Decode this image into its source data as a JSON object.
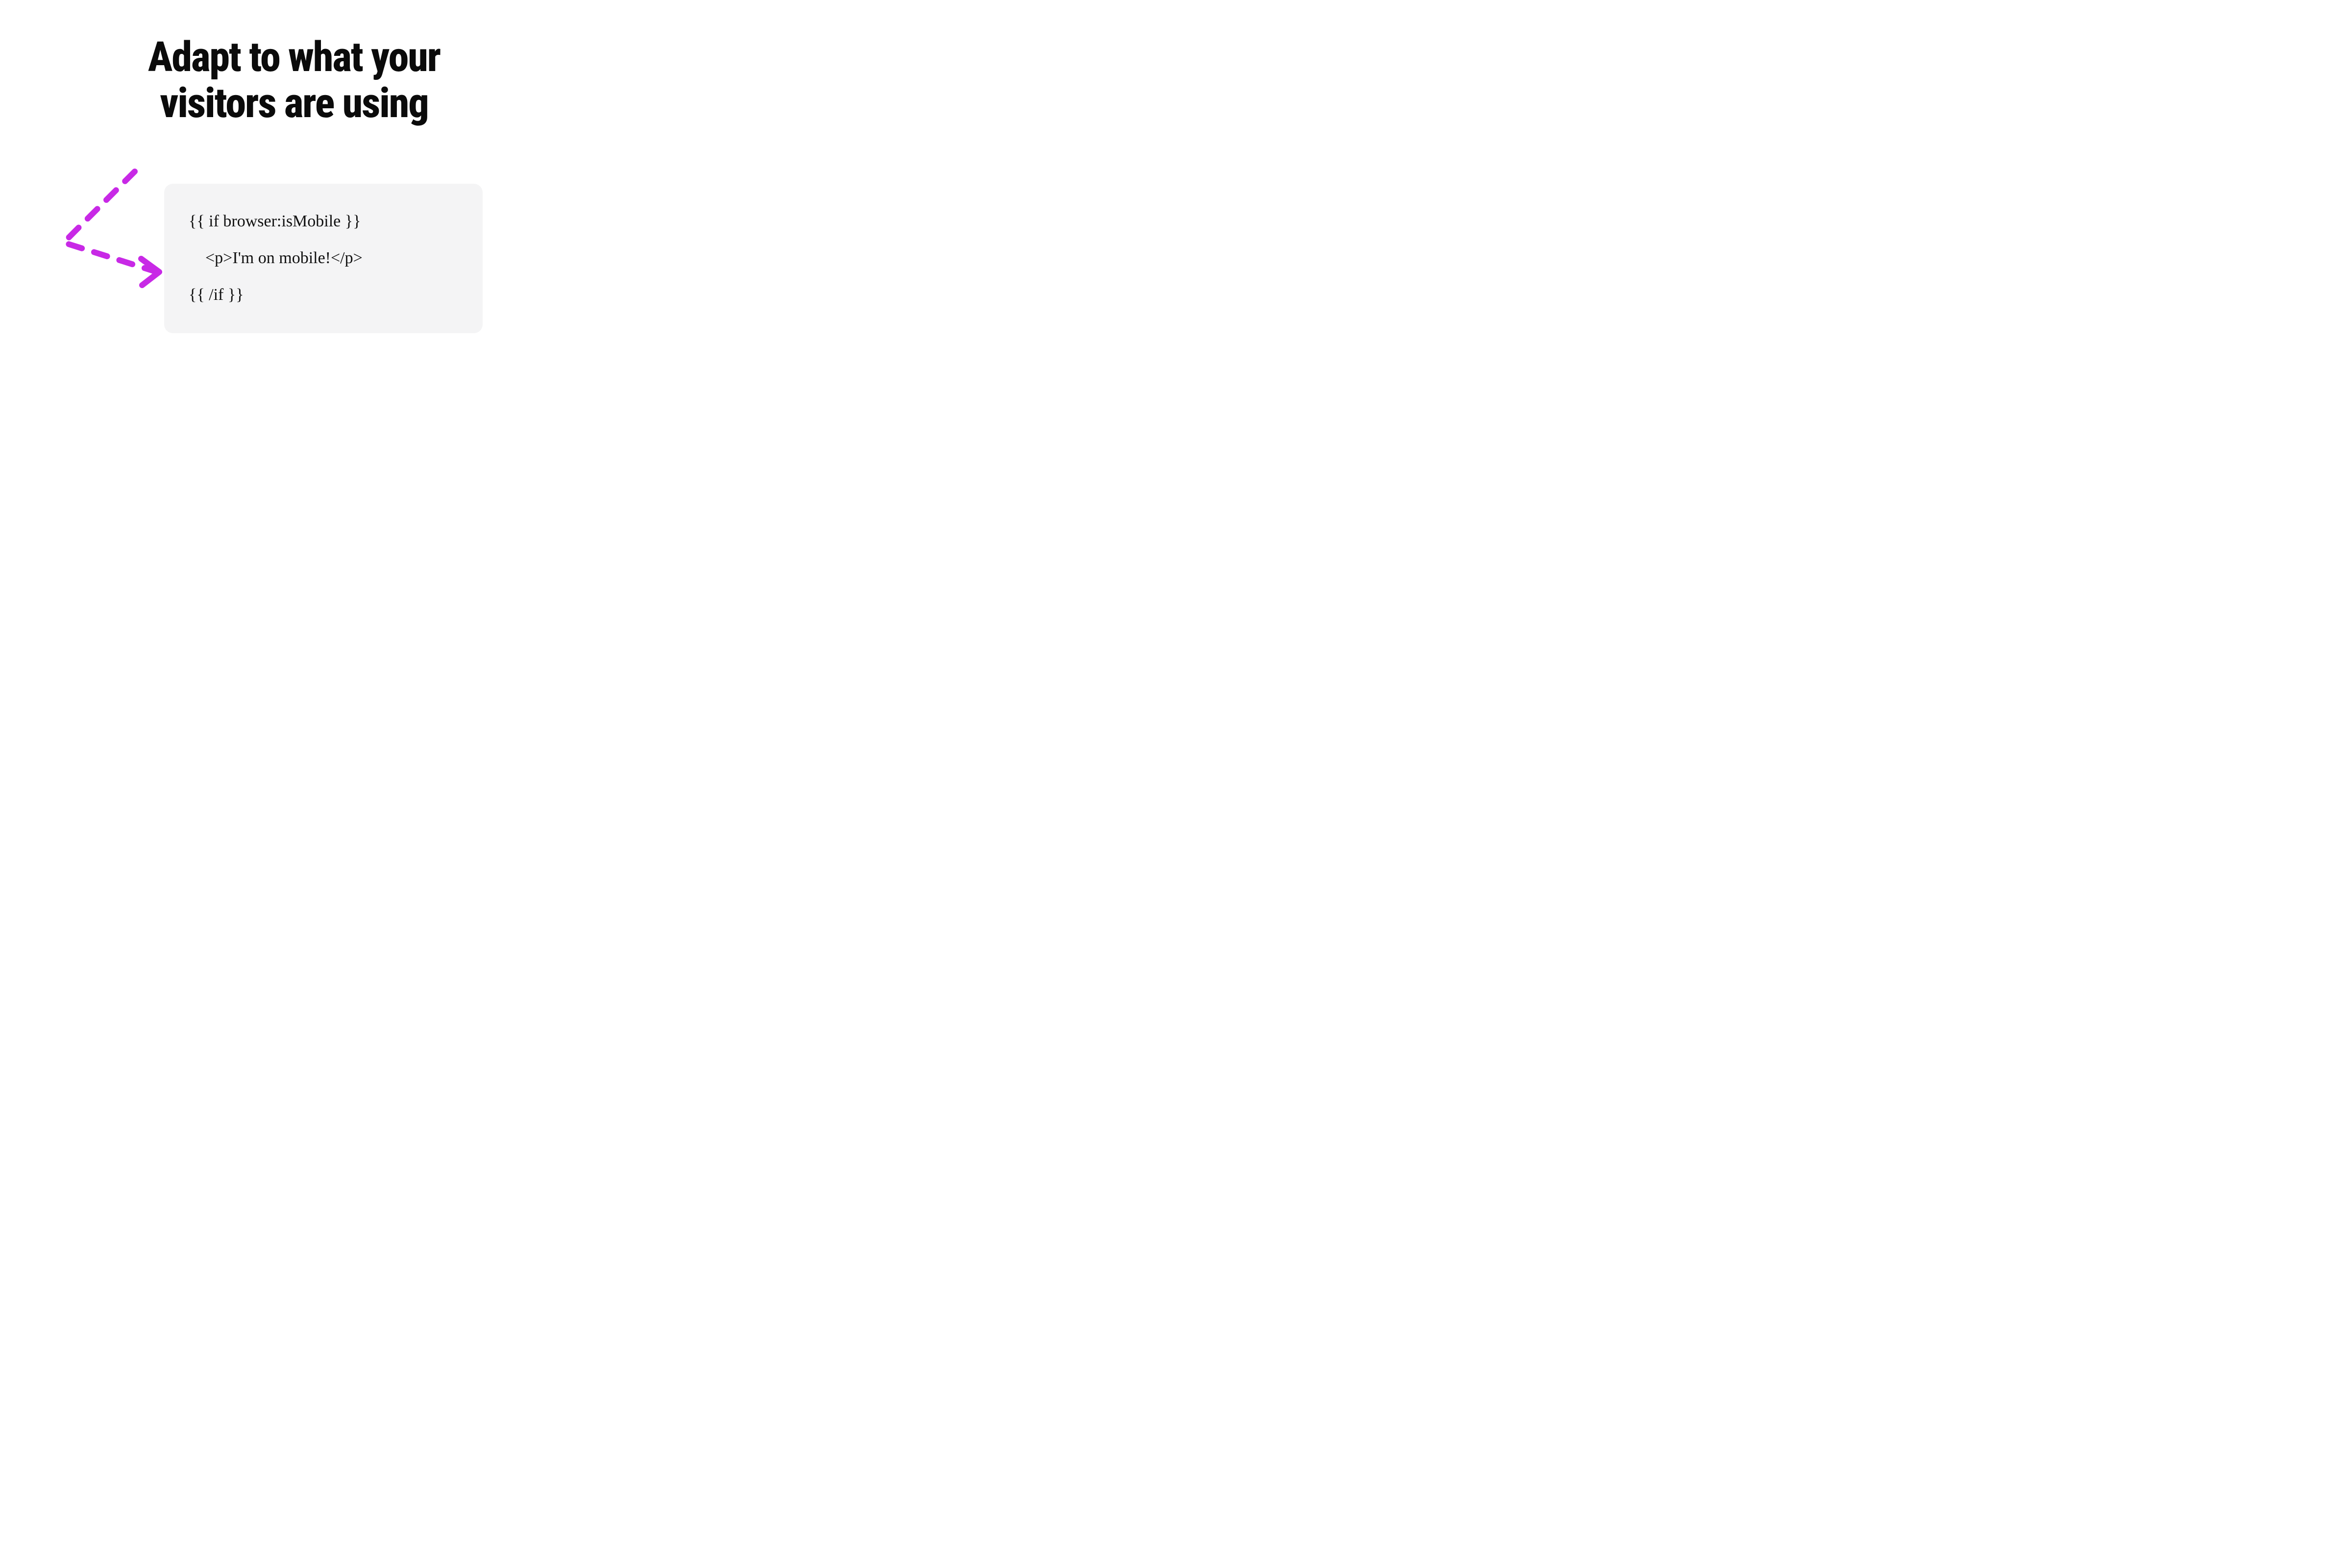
{
  "heading": "Adapt to what your\nvisitors are using",
  "code": {
    "line1": "{{ if browser:isMobile }}",
    "line2": "    <p>I'm on mobile!</p>",
    "line3": "{{ /if }}"
  },
  "colors": {
    "arrow": "#c829e6",
    "card_bg": "#f4f4f5",
    "text": "#0b0b0b"
  }
}
